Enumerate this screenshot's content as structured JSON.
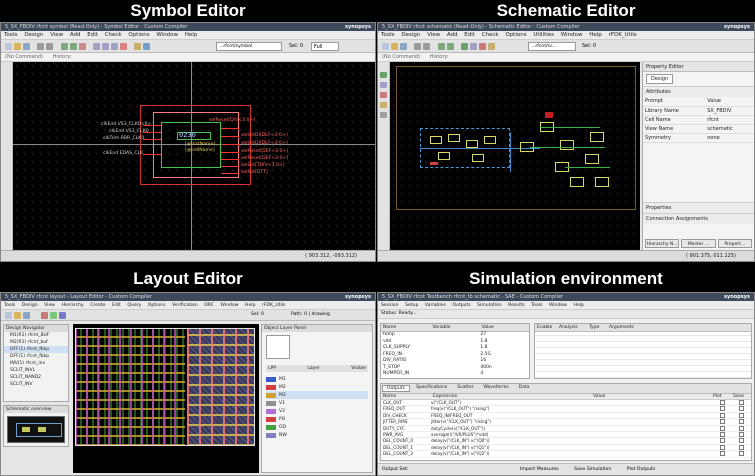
{
  "quadrants": {
    "symbol": {
      "title": "Symbol Editor"
    },
    "schematic": {
      "title": "Schematic Editor"
    },
    "layout": {
      "title": "Layout Editor"
    },
    "simulation": {
      "title": "Simulation environment"
    }
  },
  "symbol_editor": {
    "window_title": "5_SX_FBDIV rfcnt symbol (Read-Only) - Symbol Editor - Custom Compiler",
    "brand": "synopsys",
    "menu": [
      "Tools",
      "Design",
      "View",
      "Add",
      "Edit",
      "Check",
      "Options",
      "Window",
      "Help"
    ],
    "cell_field": "rfcnt symbol",
    "path_field": "...rfcnt/symbol",
    "sel_label": "Sel: 0",
    "zoom_value": "Full",
    "cmd_label": "(No Command)",
    "history_label": "History:",
    "coords": "( 903.312, -093.312)",
    "instance_id": "0230",
    "inst_name_1": "[@instName]",
    "inst_name_2": "[@cellName]",
    "left_pins": [
      "clkEnd VS3_CLK0<0>",
      "clkEnd VS3_CLK0",
      "clkTrim RBR_CLK0",
      "clkEnd EDAS_CLK"
    ],
    "right_pins": [
      "selReset[DIV<3:0>]",
      "selSetDl[DEF<3:0>]",
      "selSetDl[DEF<3:0>]",
      "selReset[DEF<3:0>]",
      "selReset[DEF<3:0>]",
      "selSet[TDIV<3:0>]",
      "selSet[DTT]"
    ]
  },
  "schematic_editor": {
    "window_title": "5_SX_FBDIV rfcnt schematic (Read-Only) - Schematic Editor - Custom Compiler",
    "brand": "synopsys",
    "menu": [
      "Tools",
      "Design",
      "View",
      "Add",
      "Edit",
      "Check",
      "Options",
      "Utilities",
      "Window",
      "Help",
      "rFDK_Utils"
    ],
    "cell_field": "...rfcnt/sc...",
    "sel_label": "Sel: 0",
    "cmd_label": "(No Command)",
    "history_label": "History:",
    "coords": "( 901.375, 011.125)",
    "property_editor": {
      "title": "Property Editor",
      "tab": "Design",
      "section_attributes": "Attributes",
      "columns": [
        "Prompt",
        "Value"
      ],
      "rows": [
        {
          "prompt": "Library Name",
          "value": "SX_FBDIV"
        },
        {
          "prompt": "Cell Name",
          "value": "rfcnt"
        },
        {
          "prompt": "View Name",
          "value": "schematic"
        },
        {
          "prompt": "Symmetry",
          "value": "none"
        }
      ],
      "section_properties": "Properties",
      "section_connection": "Connection Assignments",
      "buttons": [
        "Hierarchy N...",
        "Marker ...",
        "Propert..."
      ]
    }
  },
  "layout_editor": {
    "window_title": "5_SX_FBDIV rfcnt layout - Layout Editor - Custom Compiler",
    "brand": "synopsys",
    "menu": [
      "Tools",
      "Design",
      "View",
      "Hierarchy",
      "Create",
      "Edit",
      "Query",
      "Options",
      "Verification",
      "DRC",
      "Window",
      "Help",
      "rFDK_Utils"
    ],
    "sel_label": "Sel: 0",
    "path_label": "Path: 0 | drawing",
    "design_navigator_title": "Design Navigator",
    "nav_rows": [
      "M1(R1) rfcnt_BUF",
      "M2(R1) rfcnt_buf",
      "DFF(1) rfcnt_fbkp",
      "DFF(1) rfcnt_fbkp",
      "INV(1) rfcnt_inv",
      "SCLIT_INVL",
      "SCLIT_NAND2",
      "SCLIT_INV"
    ],
    "overview_title": "Schematic overview",
    "object_panel_title": "Object Layer Panel",
    "lpp_header": [
      "LPP",
      "Layer",
      "Visible"
    ],
    "layer_rows": [
      "M1",
      "M2",
      "M3",
      "V1",
      "V2",
      "PO",
      "OD",
      "NW"
    ]
  },
  "simulation": {
    "window_title": "5_SX_FBDIV rfcnt Testbench rfcnt_tb schematic - SAE - Custom Compiler",
    "brand": "synopsys",
    "menu": [
      "Session",
      "Setup",
      "Variables",
      "Outputs",
      "Simulation",
      "Results",
      "Tools",
      "Window",
      "Help"
    ],
    "status_text": "Status: Ready...",
    "variables_headers": [
      "Name",
      "Variable",
      "Value"
    ],
    "variables_rows": [
      {
        "name": "temp",
        "value": "27"
      },
      {
        "name": "vdd",
        "value": "1.8"
      },
      {
        "name": "CLK_SUPPLY",
        "value": "1.8"
      },
      {
        "name": "FREQ_IN",
        "value": "2.5G"
      },
      {
        "name": "DIV_RATIO",
        "value": "16"
      },
      {
        "name": "T_STOP",
        "value": "400n"
      },
      {
        "name": "NUMPER_IN",
        "value": "4"
      }
    ],
    "analyses_headers": [
      "Enable",
      "Analysis",
      "Type",
      "Arguments"
    ],
    "outputs_tabs": [
      "Outputs",
      "Specifications",
      "Scatter",
      "Waveforms",
      "Data"
    ],
    "outputs_headers": [
      "Name",
      "Expression",
      "Value",
      "Plot",
      "Save"
    ],
    "outputs_rows": [
      {
        "name": "CLK_OUT",
        "expr": "v(\"/CLK_OUT\")"
      },
      {
        "name": "FREQ_OUT",
        "expr": "freq(v(\"/CLK_OUT\") \"rising\")"
      },
      {
        "name": "DIV_CHECK",
        "expr": "FREQ_IN/FREQ_OUT"
      },
      {
        "name": "JITTER_RMS",
        "expr": "jitter(v(\"/CLK_OUT\") \"rising\")"
      },
      {
        "name": "DUTY_CYC",
        "expr": "dutyCycle(v(\"/CLK_OUT\"))"
      },
      {
        "name": "PWR_AVG",
        "expr": "average(i(\"/V0/PLUS\")*vdd)"
      },
      {
        "name": "DEL_COUNT_0",
        "expr": "delay(v(\"/CLK_IN\") v(\"/Q0\"))"
      },
      {
        "name": "DEL_COUNT_1",
        "expr": "delay(v(\"/CLK_IN\") v(\"/Q1\"))"
      },
      {
        "name": "DEL_COUNT_2",
        "expr": "delay(v(\"/CLK_IN\") v(\"/Q2\"))"
      }
    ],
    "footer_left": "Output Set:",
    "footer_items": [
      "Import Measures",
      "Save Simulation",
      "Plot Outputs"
    ]
  }
}
